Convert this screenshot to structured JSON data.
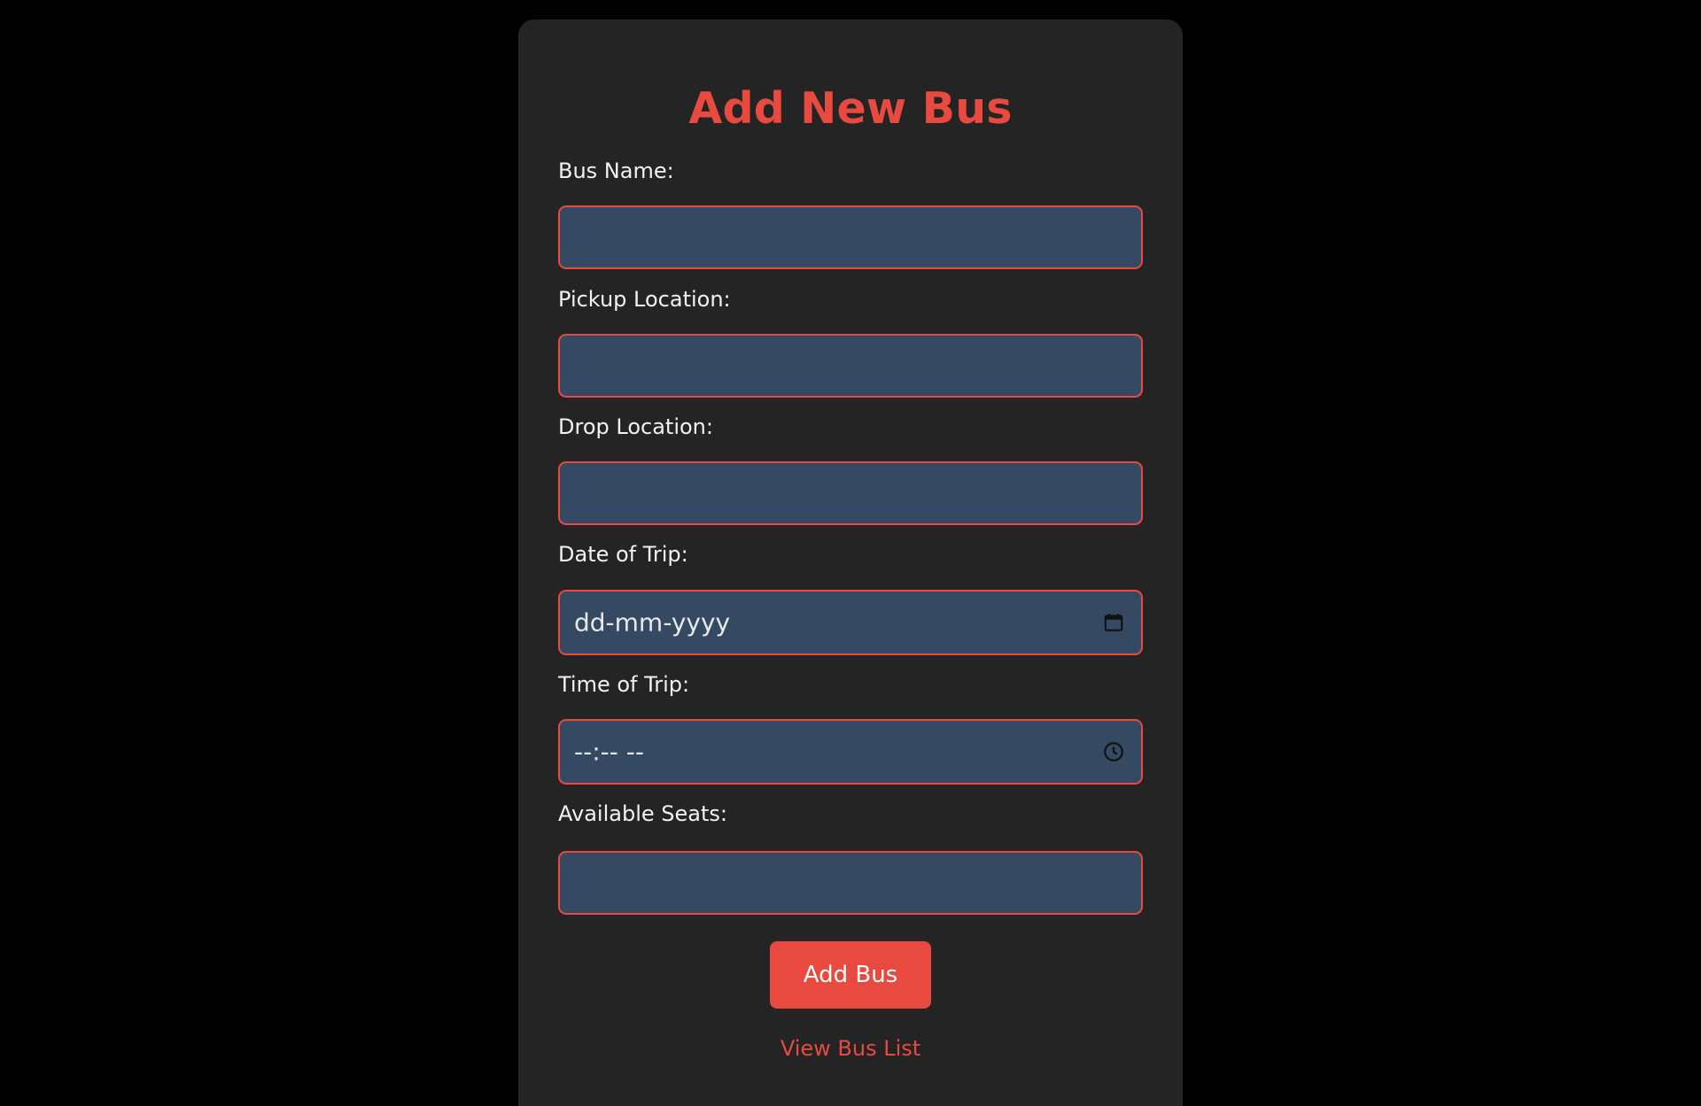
{
  "form": {
    "title": "Add New Bus",
    "fields": [
      {
        "label": "Bus Name:",
        "value": "",
        "type": "text"
      },
      {
        "label": "Pickup Location:",
        "value": "",
        "type": "text"
      },
      {
        "label": "Drop Location:",
        "value": "",
        "type": "text"
      },
      {
        "label": "Date of Trip:",
        "placeholder": "dd-mm-yyyy",
        "type": "date",
        "icon": "calendar-icon"
      },
      {
        "label": "Time of Trip:",
        "placeholder": "--:-- --",
        "type": "time",
        "icon": "clock-icon"
      },
      {
        "label": "Available Seats:",
        "value": "",
        "type": "number"
      }
    ],
    "submit_label": "Add Bus",
    "link_label": "View Bus List"
  },
  "colors": {
    "background": "#000000",
    "card": "#242424",
    "accent": "#e84a3f",
    "input_bg": "#354a62",
    "label_text": "#f2f2f2"
  }
}
